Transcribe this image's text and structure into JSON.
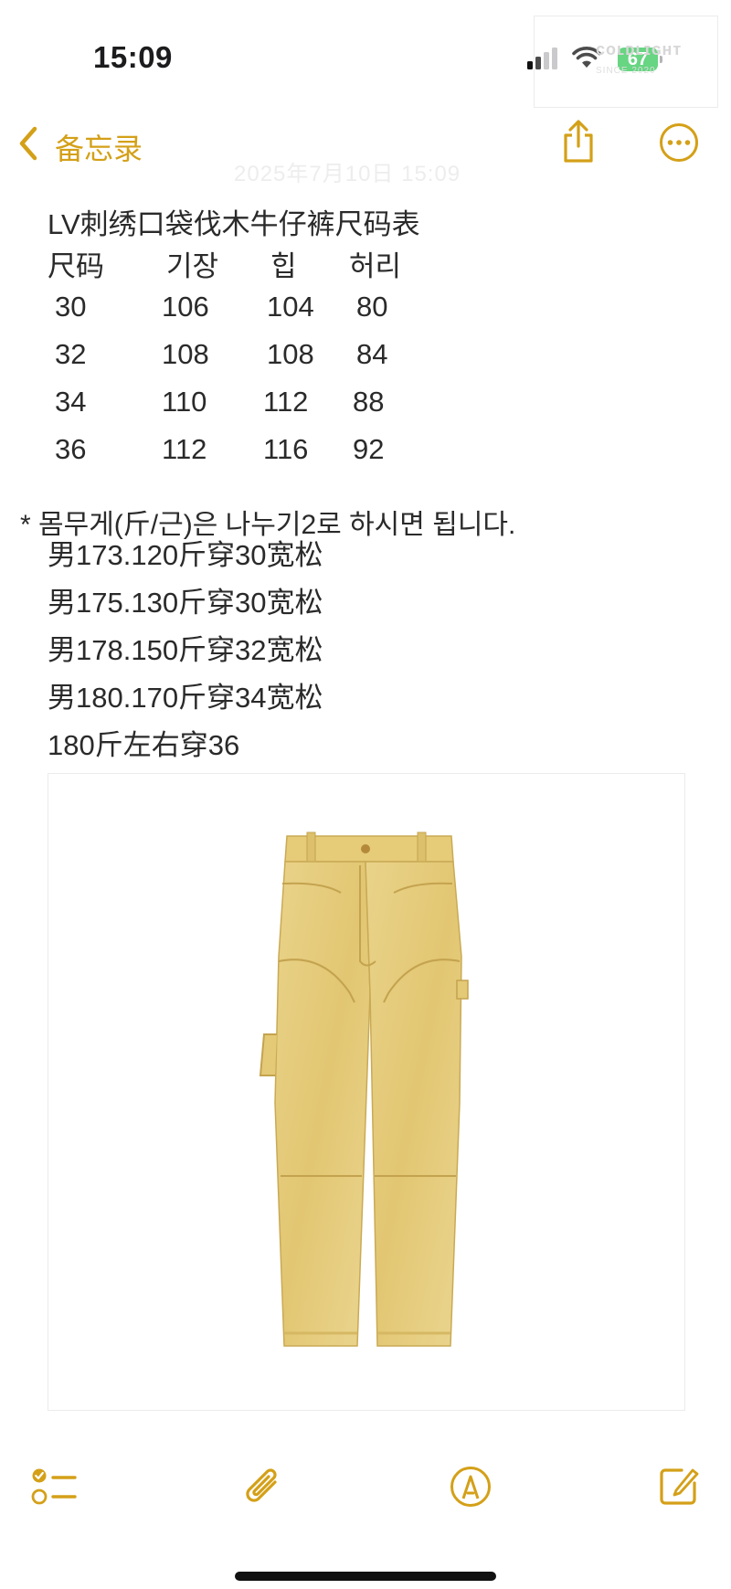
{
  "status_bar": {
    "time": "15:09",
    "battery": "67",
    "watermark": "ᴄᴏʟᴅʟɪɢʜᴛ",
    "watermark_sub": "SINCE 2020"
  },
  "nav": {
    "back_label": "备忘录",
    "faint_date": "2025年7月10日 15:09"
  },
  "note": {
    "title": "LV刺绣口袋伐木牛仔裤尺码表",
    "size_table": {
      "headers": [
        "尺码",
        "기장",
        "힙",
        "허리"
      ],
      "rows": [
        [
          "30",
          "106",
          "104",
          "80"
        ],
        [
          "32",
          "108",
          "108",
          "84"
        ],
        [
          "34",
          "110",
          "112",
          "88"
        ],
        [
          "36",
          "112",
          "116",
          "92"
        ]
      ]
    },
    "korean_note": "* 몸무게(斤/근)은 나누기2로 하시면 됩니다.",
    "recommendations": [
      "男173.120斤穿30宽松",
      "男175.130斤穿30宽松",
      "男178.150斤穿32宽松",
      "男180.170斤穿34宽松",
      "180斤左右穿36"
    ]
  },
  "colors": {
    "accent": "#d4a018",
    "text": "#2a2a2a",
    "battery_green": "#35c759",
    "jeans": "#e6cd7e"
  },
  "icons": [
    "back-chevron-icon",
    "share-icon",
    "more-icon",
    "checklist-icon",
    "attachment-icon",
    "markup-icon",
    "compose-icon"
  ]
}
